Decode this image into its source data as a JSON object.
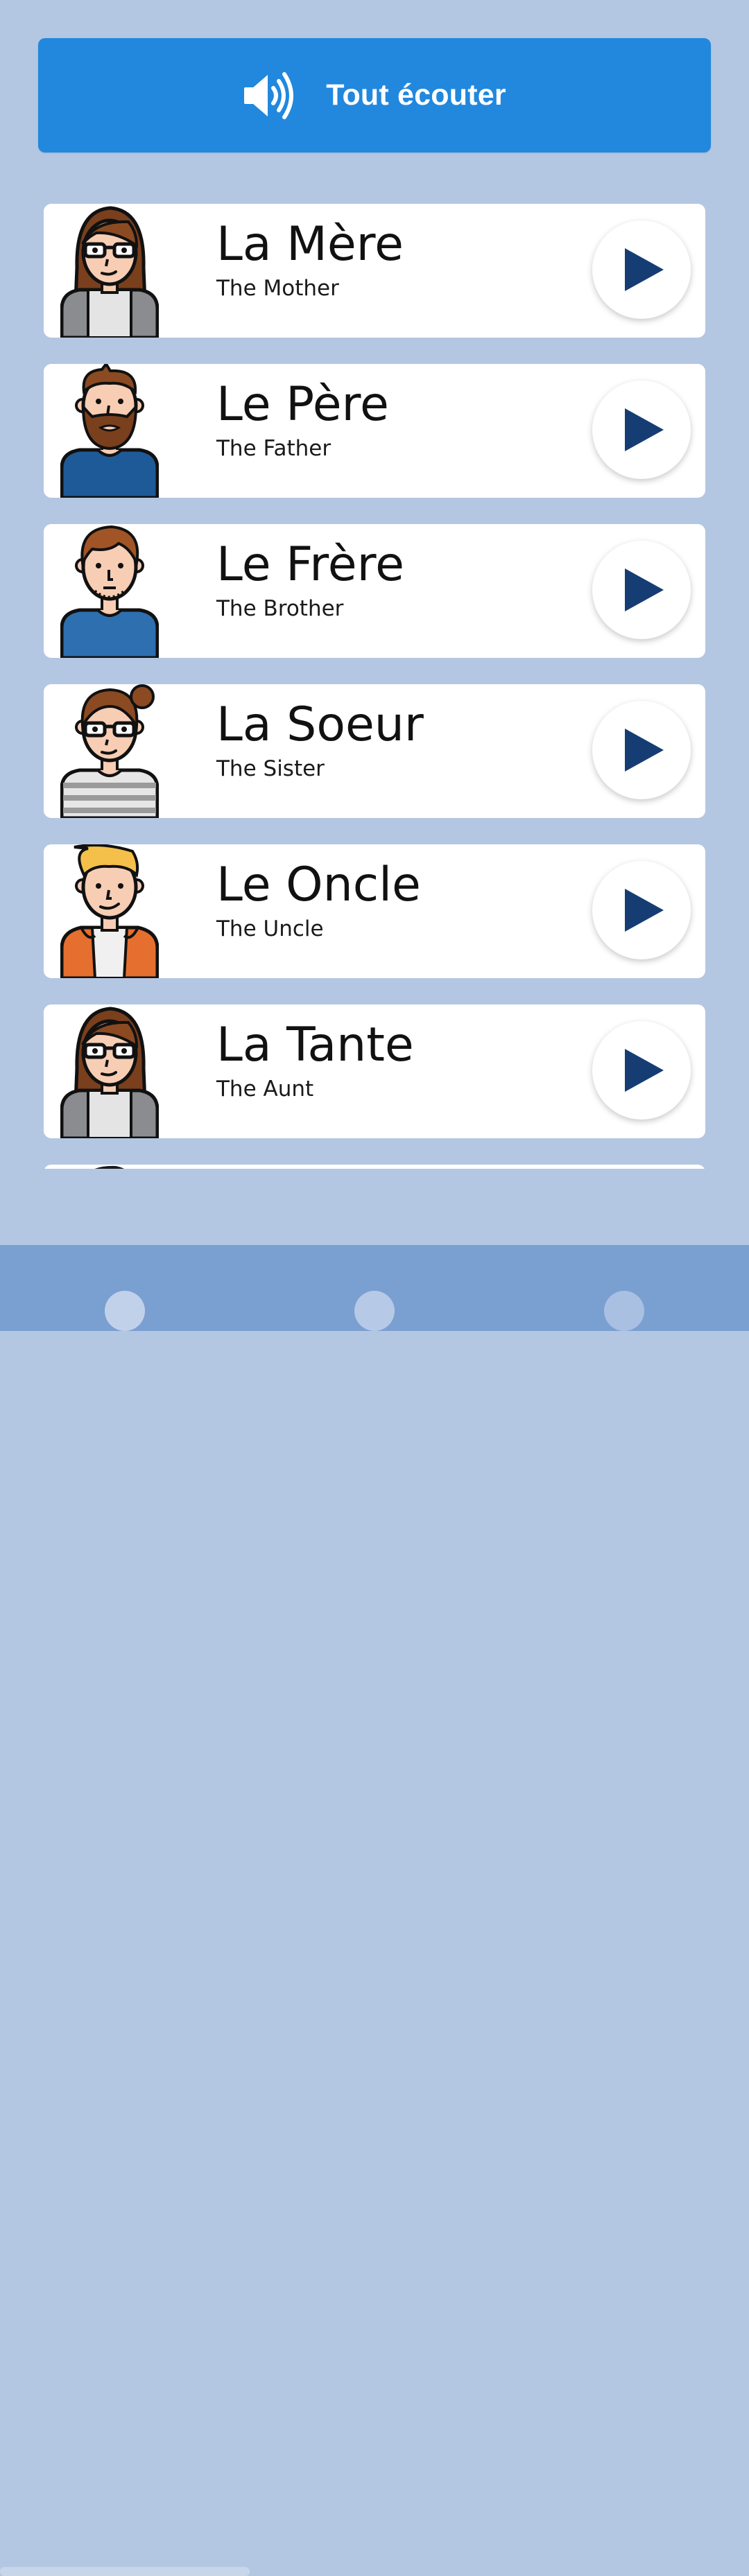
{
  "listen_all": {
    "label": "Tout écouter",
    "icon": "speaker-volume-icon"
  },
  "family_members": [
    {
      "word": "La Mère",
      "translation": "The Mother",
      "avatar": "mother-avatar"
    },
    {
      "word": "Le Père",
      "translation": "The Father",
      "avatar": "father-avatar"
    },
    {
      "word": "Le Frère",
      "translation": "The Brother",
      "avatar": "brother-avatar"
    },
    {
      "word": "La Soeur",
      "translation": "The Sister",
      "avatar": "sister-avatar"
    },
    {
      "word": "Le Oncle",
      "translation": "The Uncle",
      "avatar": "uncle-avatar"
    },
    {
      "word": "La Tante",
      "translation": "The Aunt",
      "avatar": "aunt-avatar"
    }
  ],
  "play_icon": "play-icon",
  "colors": {
    "background": "#b3c7e3",
    "primary_button": "#2188dd",
    "play_triangle": "#163d73",
    "bottom_nav": "#7a9fd1"
  },
  "bottom_nav": {
    "items": [
      {
        "icon": "nav-dot-icon"
      },
      {
        "icon": "nav-dot-icon"
      },
      {
        "icon": "nav-dot-icon"
      }
    ]
  }
}
